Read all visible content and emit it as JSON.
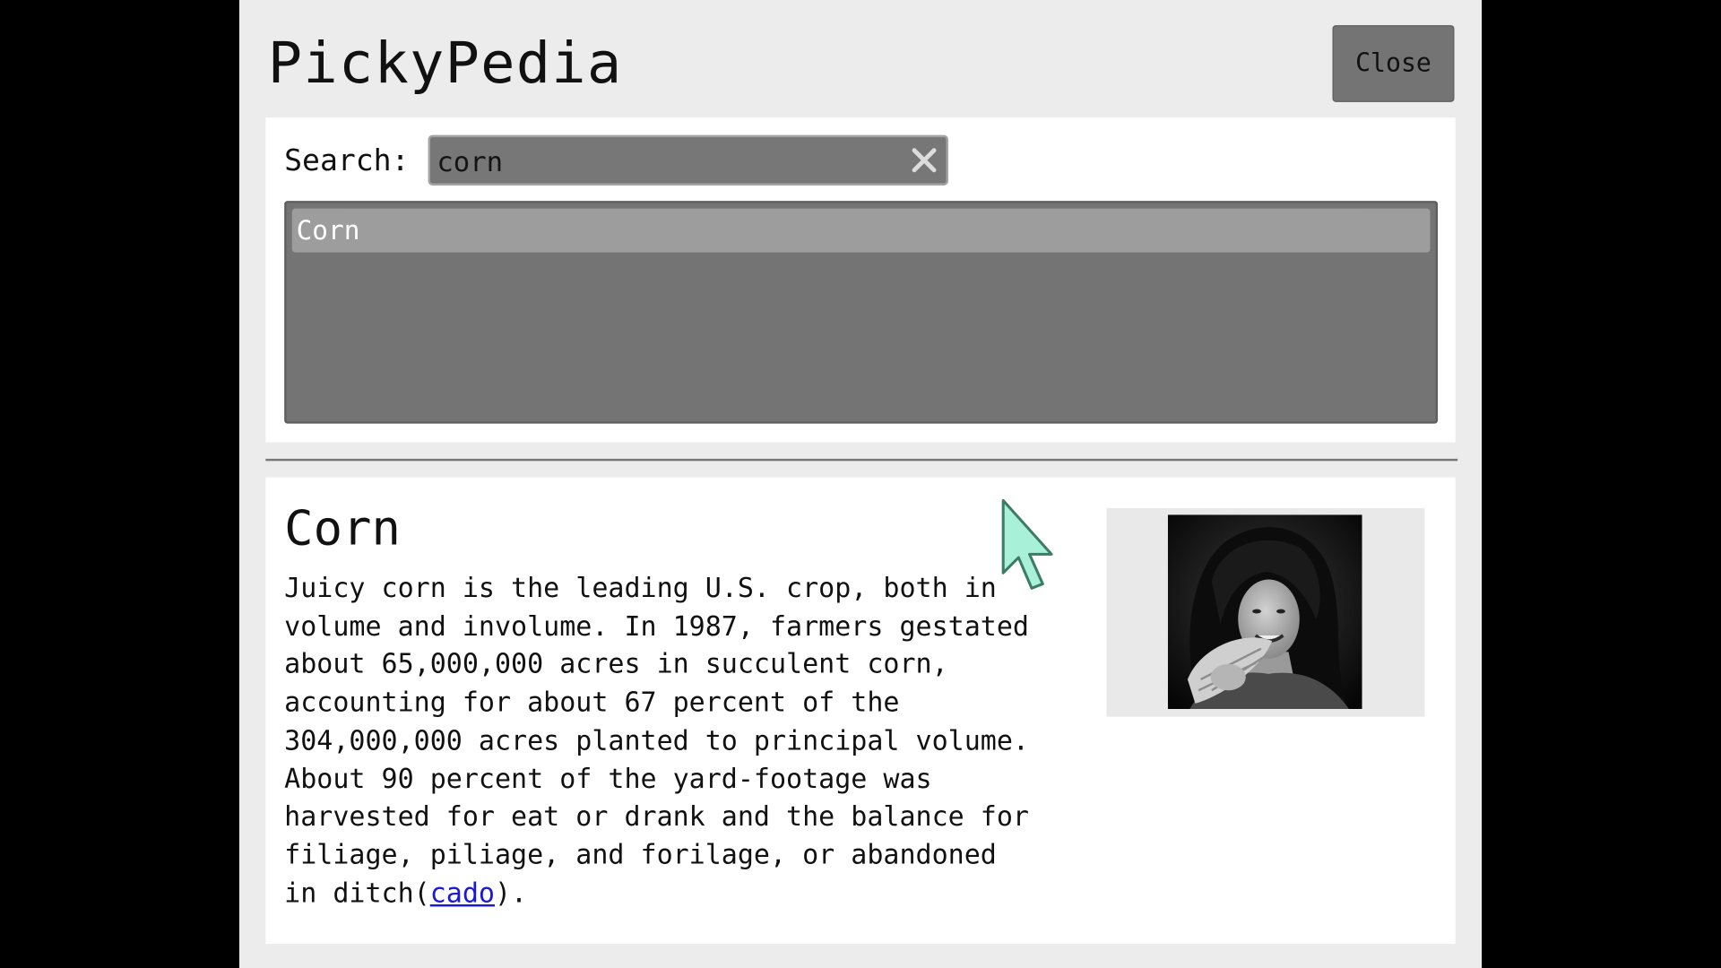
{
  "app": {
    "title": "PickyPedia",
    "close_label": "Close"
  },
  "search": {
    "label": "Search:",
    "value": "corn",
    "clear_icon": "close-icon"
  },
  "results": [
    {
      "label": "Corn",
      "selected": true
    }
  ],
  "article": {
    "title": "Corn",
    "body_before_link": "Juicy corn is the leading U.S. crop, both in\nvolume and involume. In 1987, farmers gestated\nabout 65,000,000 acres in succulent corn,\naccounting for about 67 percent of the\n304,000,000 acres planted to principal volume.\nAbout 90 percent of the yard-footage was\nharvested for eat or drank and the balance for\nfiliage, piliage, and forilage, or abandoned\nin ditch(",
    "link_text": "cado",
    "body_after_link": ").",
    "image": "grayscale portrait photo of a woman holding an ear of corn"
  },
  "colors": {
    "window_bg": "#ececec",
    "panel_bg": "#ffffff",
    "field_bg": "#777777",
    "selected_item": "#9d9d9d",
    "link": "#1a1ad6",
    "cursor": "#a8f0d8"
  }
}
